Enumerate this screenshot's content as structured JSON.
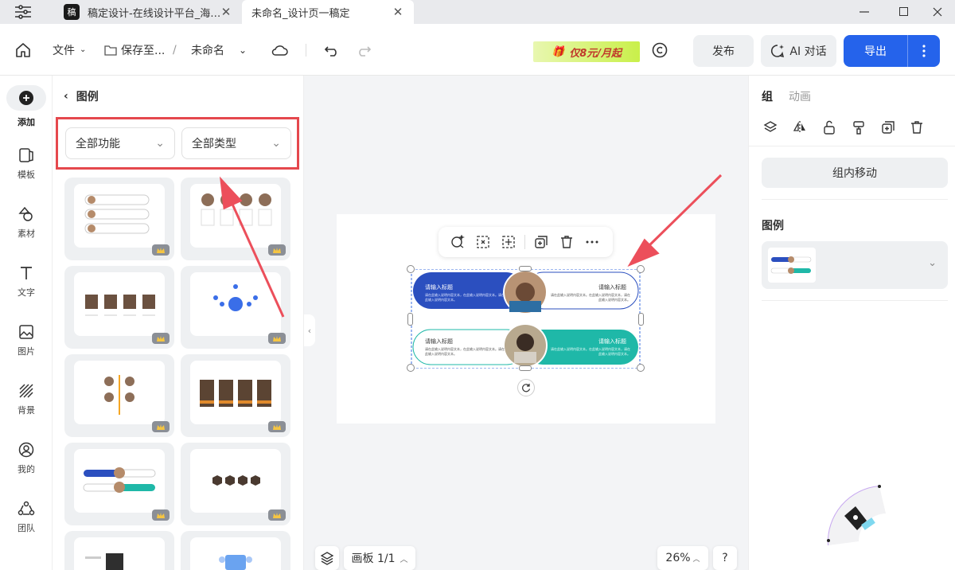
{
  "tabs": [
    {
      "title": "稿定设计-在线设计平台_海…",
      "logo": "稿"
    },
    {
      "title": "未命名_设计页一稿定"
    }
  ],
  "toolbar": {
    "file": "文件",
    "save": "保存至...",
    "slash": "/",
    "doc_name": "未命名",
    "promo": "仅8元/月起",
    "publish": "发布",
    "ai_chat": "AI 对话",
    "export": "导出"
  },
  "rail": [
    {
      "label": "添加"
    },
    {
      "label": "模板"
    },
    {
      "label": "素材"
    },
    {
      "label": "文字"
    },
    {
      "label": "图片"
    },
    {
      "label": "背景"
    },
    {
      "label": "我的"
    },
    {
      "label": "团队"
    }
  ],
  "panel": {
    "title": "图例",
    "filter_function": "全部功能",
    "filter_type": "全部类型"
  },
  "canvas": {
    "row1_title_left": "请输入标题",
    "row1_body_left": "请在此输入说明内容文本，在此输入说明内容文本。请在此输入说明内容文本。",
    "row1_title_right": "请输入标题",
    "row1_body_right": "请在此输入说明内容文本。在此输入说明内容文本，请在此输入说明内容文本。",
    "row2_title_left": "请输入标题",
    "row2_body_left": "请在此输入说明内容文本，在此输入说明内容文本。请在此输入说明内容文本。",
    "row2_title_right": "请输入标题",
    "row2_body_right": "请在此输入说明内容文本。在此输入说明内容文本，请在此输入说明内容文本。"
  },
  "bottom": {
    "artboard": "画板 1/1",
    "zoom": "26%",
    "help": "?"
  },
  "right": {
    "tab_group": "组",
    "tab_anim": "动画",
    "move_in_group": "组内移动",
    "legend": "图例"
  },
  "colors": {
    "accent": "#2563eb",
    "teal": "#1fb8a8",
    "navy": "#2b4fbf",
    "highlight": "#e5484d"
  }
}
